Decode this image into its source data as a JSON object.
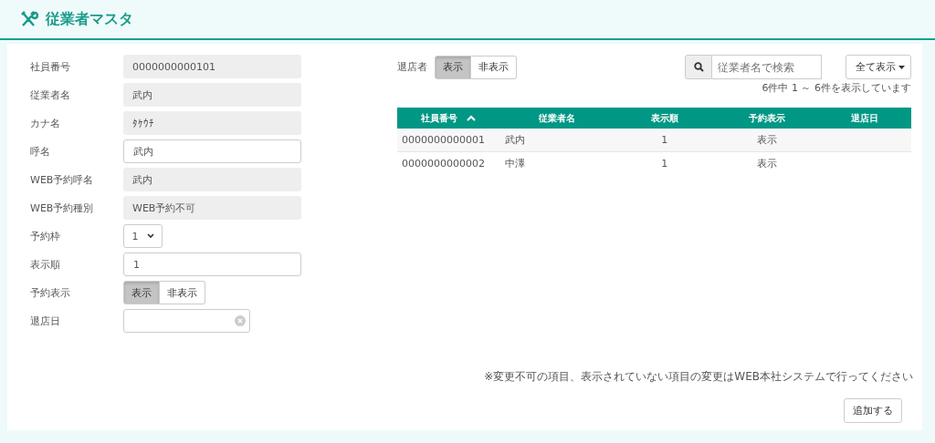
{
  "header": {
    "title": "従業者マスタ"
  },
  "form": [
    {
      "label": "社員番号",
      "kind": "readonly",
      "value": "0000000000101"
    },
    {
      "label": "従業者名",
      "kind": "readonly",
      "value": "武内"
    },
    {
      "label": "カナ名",
      "kind": "readonly",
      "value": "ﾀｹｳﾁ"
    },
    {
      "label": "呼名",
      "kind": "input",
      "value": "武内"
    },
    {
      "label": "WEB予約呼名",
      "kind": "readonly",
      "value": "武内"
    },
    {
      "label": "WEB予約種別",
      "kind": "readonly",
      "value": "WEB予約不可"
    },
    {
      "label": "予約枠",
      "kind": "select",
      "value": "1"
    },
    {
      "label": "表示順",
      "kind": "input",
      "value": "1"
    },
    {
      "label": "予約表示",
      "kind": "toggle",
      "options": [
        {
          "label": "表示",
          "selected": true
        },
        {
          "label": "非表示",
          "selected": false
        }
      ]
    },
    {
      "label": "退店日",
      "kind": "date"
    }
  ],
  "filter": {
    "label": "退店者",
    "options": [
      {
        "label": "表示",
        "selected": true
      },
      {
        "label": "非表示",
        "selected": false
      }
    ]
  },
  "search": {
    "placeholder": "従業者名で検索"
  },
  "show_all": {
    "label": "全て表示"
  },
  "count": "6件中 1 ～ 6件を表示しています",
  "table": {
    "columns": [
      {
        "label": "社員番号",
        "sorted": true
      },
      {
        "label": "従業者名",
        "sorted": false
      },
      {
        "label": "表示順",
        "sorted": false
      },
      {
        "label": "予約表示",
        "sorted": false
      },
      {
        "label": "退店日",
        "sorted": false
      }
    ],
    "rows": [
      [
        "0000000000001",
        "武内",
        "1",
        "表示",
        null
      ],
      [
        "0000000000002",
        "中澤",
        "1",
        "表示",
        null
      ]
    ]
  },
  "note": "※変更不可の項目、表示されていない項目の変更はWEB本社システムで行ってください",
  "add_button": "追加する"
}
